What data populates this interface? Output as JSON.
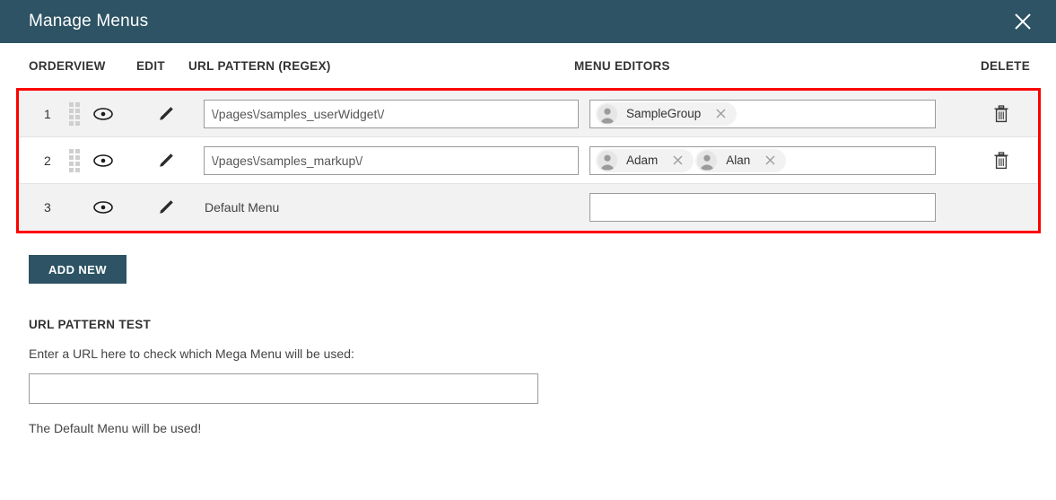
{
  "window": {
    "title": "Manage Menus",
    "close_icon": "close-x-icon"
  },
  "table": {
    "headers": {
      "order": "ORDER",
      "view": "VIEW",
      "edit": "EDIT",
      "url_pattern": "URL PATTERN (REGEX)",
      "menu_editors": "MENU EDITORS",
      "delete": "DELETE"
    },
    "highlight_color": "#ff0000",
    "rows": [
      {
        "order": "1",
        "has_drag_handle": true,
        "view_icon": "eye-icon",
        "edit_icon": "pencil-icon",
        "url_pattern": "\\/pages\\/samples_userWidget\\/",
        "url_editable": true,
        "editors": [
          {
            "name": "SampleGroup",
            "avatar": "user-avatar-icon",
            "remove_icon": "close-x-icon"
          }
        ],
        "has_editors_box": true,
        "delete_icon": "trash-icon",
        "has_delete": true
      },
      {
        "order": "2",
        "has_drag_handle": true,
        "view_icon": "eye-icon",
        "edit_icon": "pencil-icon",
        "url_pattern": "\\/pages\\/samples_markup\\/",
        "url_editable": true,
        "editors": [
          {
            "name": "Adam",
            "avatar": "user-avatar-icon",
            "remove_icon": "close-x-icon"
          },
          {
            "name": "Alan",
            "avatar": "user-avatar-icon",
            "remove_icon": "close-x-icon"
          }
        ],
        "has_editors_box": true,
        "delete_icon": "trash-icon",
        "has_delete": true
      },
      {
        "order": "3",
        "has_drag_handle": false,
        "view_icon": "eye-icon",
        "edit_icon": "pencil-icon",
        "url_pattern": "Default Menu",
        "url_editable": false,
        "editors": [],
        "has_editors_box": true,
        "delete_icon": "",
        "has_delete": false
      }
    ]
  },
  "actions": {
    "add_new_label": "ADD NEW",
    "add_new_color": "#2d5364"
  },
  "url_pattern_test": {
    "title": "URL PATTERN TEST",
    "description": "Enter a URL here to check which Mega Menu will be used:",
    "input_value": "",
    "input_placeholder": "",
    "result": "The Default Menu will be used!"
  },
  "theme": {
    "titlebar_bg": "#2d5364",
    "row_alt_bg": "#f2f2f2",
    "row_bg": "#ffffff"
  }
}
